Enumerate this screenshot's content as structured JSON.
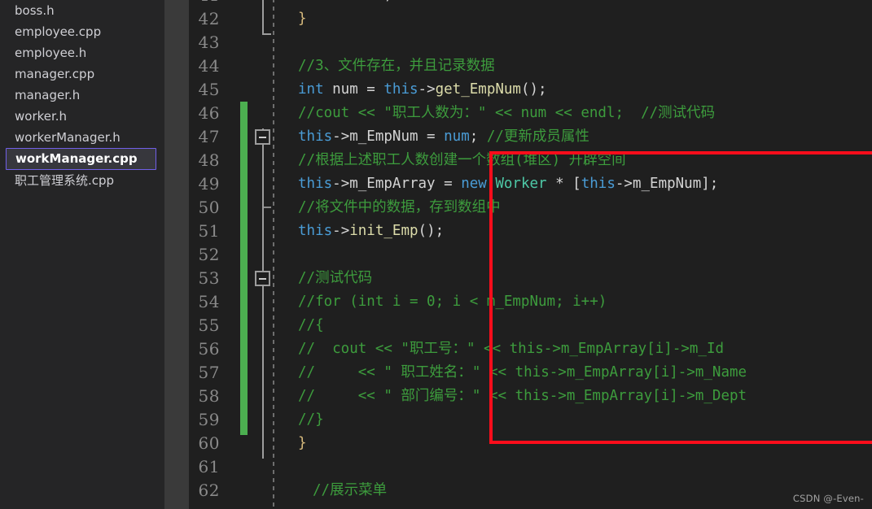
{
  "sidebar": {
    "name": "explorer-file-list",
    "files": [
      {
        "label": "boss.h",
        "selected": false
      },
      {
        "label": "employee.cpp",
        "selected": false
      },
      {
        "label": "employee.h",
        "selected": false
      },
      {
        "label": "manager.cpp",
        "selected": false
      },
      {
        "label": "manager.h",
        "selected": false
      },
      {
        "label": "worker.h",
        "selected": false
      },
      {
        "label": "workerManager.h",
        "selected": false
      },
      {
        "label": "workManager.cpp",
        "selected": true
      },
      {
        "label": "职工管理系统.cpp",
        "selected": false
      }
    ],
    "selected_border_color": "#7160e8",
    "selected_bg_color": "#37373d",
    "background_color": "#252526"
  },
  "editor": {
    "name": "code-editor",
    "background_color": "#1f1f1f",
    "line_number_color": "#8a8a8a",
    "change_bar_color": "#4caf50",
    "annotation_box_color": "#fc0d1b",
    "first_visible_line": 41,
    "last_visible_line": 62,
    "lines": [
      {
        "num": 41,
        "indent": 0,
        "clipped_top": true,
        "tokens": [
          {
            "t": "    ",
            "c": "plain"
          },
          {
            "t": "return",
            "c": "kw2"
          },
          {
            "t": ";",
            "c": "plain"
          }
        ]
      },
      {
        "num": 42,
        "indent": 0,
        "tokens": [
          {
            "t": "}",
            "c": "brace1"
          }
        ]
      },
      {
        "num": 43,
        "indent": 0,
        "tokens": []
      },
      {
        "num": 44,
        "indent": 0,
        "tokens": [
          {
            "t": "//3、文件存在，并且记录数据",
            "c": "comment"
          }
        ]
      },
      {
        "num": 45,
        "indent": 0,
        "tokens": [
          {
            "t": "int",
            "c": "keyword"
          },
          {
            "t": " num ",
            "c": "plain"
          },
          {
            "t": "= ",
            "c": "plain"
          },
          {
            "t": "this",
            "c": "keyword"
          },
          {
            "t": "->",
            "c": "plain"
          },
          {
            "t": "get_EmpNum",
            "c": "func"
          },
          {
            "t": "();",
            "c": "plain"
          }
        ]
      },
      {
        "num": 46,
        "indent": 0,
        "tokens": [
          {
            "t": "//cout << \"职工人数为：\" << num << endl;  //测试代码",
            "c": "comment"
          }
        ]
      },
      {
        "num": 47,
        "indent": 0,
        "tokens": [
          {
            "t": "this",
            "c": "keyword"
          },
          {
            "t": "->m_EmpNum = ",
            "c": "plain"
          },
          {
            "t": "num",
            "c": "keyword"
          },
          {
            "t": "; ",
            "c": "plain"
          },
          {
            "t": "//更新成员属性",
            "c": "comment"
          }
        ]
      },
      {
        "num": 48,
        "indent": 0,
        "tokens": [
          {
            "t": "//根据上述职工人数创建一个数组(堆区) 开辟空间",
            "c": "comment"
          }
        ]
      },
      {
        "num": 49,
        "indent": 0,
        "tokens": [
          {
            "t": "this",
            "c": "keyword"
          },
          {
            "t": "->m_EmpArray = ",
            "c": "plain"
          },
          {
            "t": "new",
            "c": "keyword"
          },
          {
            "t": " ",
            "c": "plain"
          },
          {
            "t": "Worker",
            "c": "type"
          },
          {
            "t": " * [",
            "c": "plain"
          },
          {
            "t": "this",
            "c": "keyword"
          },
          {
            "t": "->m_EmpNum];",
            "c": "plain"
          }
        ]
      },
      {
        "num": 50,
        "indent": 0,
        "tokens": [
          {
            "t": "//将文件中的数据，存到数组中",
            "c": "comment"
          }
        ]
      },
      {
        "num": 51,
        "indent": 0,
        "tokens": [
          {
            "t": "this",
            "c": "keyword"
          },
          {
            "t": "->",
            "c": "plain"
          },
          {
            "t": "init_Emp",
            "c": "func"
          },
          {
            "t": "();",
            "c": "plain"
          }
        ]
      },
      {
        "num": 52,
        "indent": 0,
        "tokens": []
      },
      {
        "num": 53,
        "indent": 0,
        "tokens": [
          {
            "t": "//测试代码",
            "c": "comment"
          }
        ]
      },
      {
        "num": 54,
        "indent": 0,
        "tokens": [
          {
            "t": "//for (int i = 0; i < m_EmpNum; i++)",
            "c": "comment"
          }
        ]
      },
      {
        "num": 55,
        "indent": 0,
        "tokens": [
          {
            "t": "//{",
            "c": "comment"
          }
        ]
      },
      {
        "num": 56,
        "indent": 0,
        "tokens": [
          {
            "t": "//  cout << \"职工号：\" << this->m_EmpArray[i]->m_Id",
            "c": "comment"
          }
        ]
      },
      {
        "num": 57,
        "indent": 0,
        "tokens": [
          {
            "t": "//     << \" 职工姓名：\" << this->m_EmpArray[i]->m_Name",
            "c": "comment"
          }
        ]
      },
      {
        "num": 58,
        "indent": 0,
        "tokens": [
          {
            "t": "//     << \" 部门编号：\" << this->m_EmpArray[i]->m_Dept",
            "c": "comment"
          }
        ]
      },
      {
        "num": 59,
        "indent": 0,
        "tokens": [
          {
            "t": "//}",
            "c": "comment"
          }
        ]
      },
      {
        "num": 60,
        "indent": 0,
        "tokens": [
          {
            "t": "}",
            "c": "brace1"
          }
        ]
      },
      {
        "num": 61,
        "indent": 0,
        "tokens": []
      },
      {
        "num": 62,
        "indent": 1,
        "tokens": [
          {
            "t": "//展示菜单",
            "c": "comment"
          }
        ]
      }
    ]
  },
  "watermark": {
    "text": "CSDN @-Even-"
  }
}
